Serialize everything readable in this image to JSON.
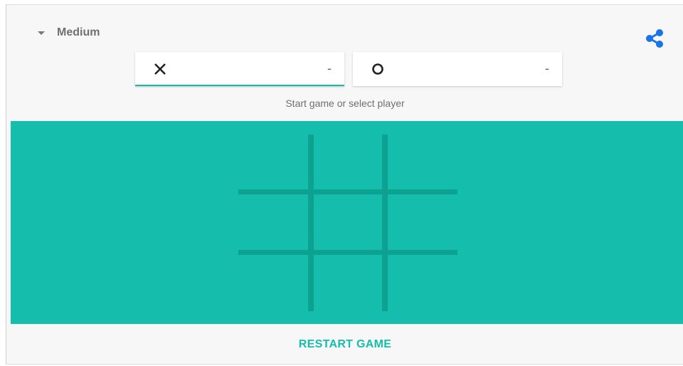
{
  "difficulty": {
    "label": "Medium"
  },
  "players": [
    {
      "symbol": "X",
      "score": "-"
    },
    {
      "symbol": "O",
      "score": "-"
    }
  ],
  "status": "Start game or select player",
  "footer": {
    "restart_label": "RESTART GAME"
  },
  "colors": {
    "accent": "#14bdac",
    "grid": "#0da192",
    "share_icon": "#1a73e8"
  },
  "icons": [
    "caret-down-icon",
    "share-icon",
    "x-mark-icon",
    "o-mark-icon"
  ]
}
